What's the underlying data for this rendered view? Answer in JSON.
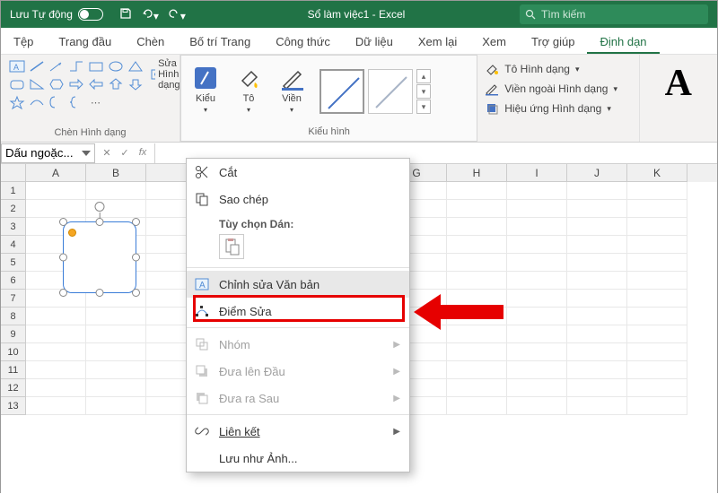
{
  "titlebar": {
    "autosave": "Lưu Tự động",
    "document": "Sổ làm việc1 - Excel",
    "search_placeholder": "Tìm kiếm"
  },
  "tabs": [
    "Tệp",
    "Trang đầu",
    "Chèn",
    "Bố trí Trang",
    "Công thức",
    "Dữ liệu",
    "Xem lại",
    "Xem",
    "Trợ giúp",
    "Định dạn"
  ],
  "active_tab_index": 9,
  "ribbon": {
    "shape_edit_label": "Sửa Hình dạng",
    "group1_label": "Chèn Hình dạng",
    "style_btn": "Kiểu",
    "fill_btn": "Tô",
    "outline_btn": "Viền",
    "group2_label": "Kiểu hình",
    "fill_opt": "Tô Hình dạng",
    "outline_opt": "Viền ngoài Hình dạng",
    "effects_opt": "Hiệu ứng Hình dạng",
    "wordart_sample": "A"
  },
  "namebox": "Dấu ngoặc...",
  "columns": [
    "A",
    "B",
    "",
    "",
    "",
    "",
    "G",
    "H",
    "I",
    "J",
    "K"
  ],
  "rows": [
    1,
    2,
    3,
    4,
    5,
    6,
    7,
    8,
    9,
    10,
    11,
    12,
    13
  ],
  "context_menu": {
    "cut": "Cắt",
    "copy": "Sao chép",
    "paste_label": "Tùy chọn Dán:",
    "edit_text": "Chỉnh sửa Văn bản",
    "edit_points": "Điểm Sửa",
    "group": "Nhóm",
    "bring_front": "Đưa lên Đầu",
    "send_back": "Đưa ra Sau",
    "link": "Liên kết",
    "save_as_pic": "Lưu như Ảnh..."
  }
}
